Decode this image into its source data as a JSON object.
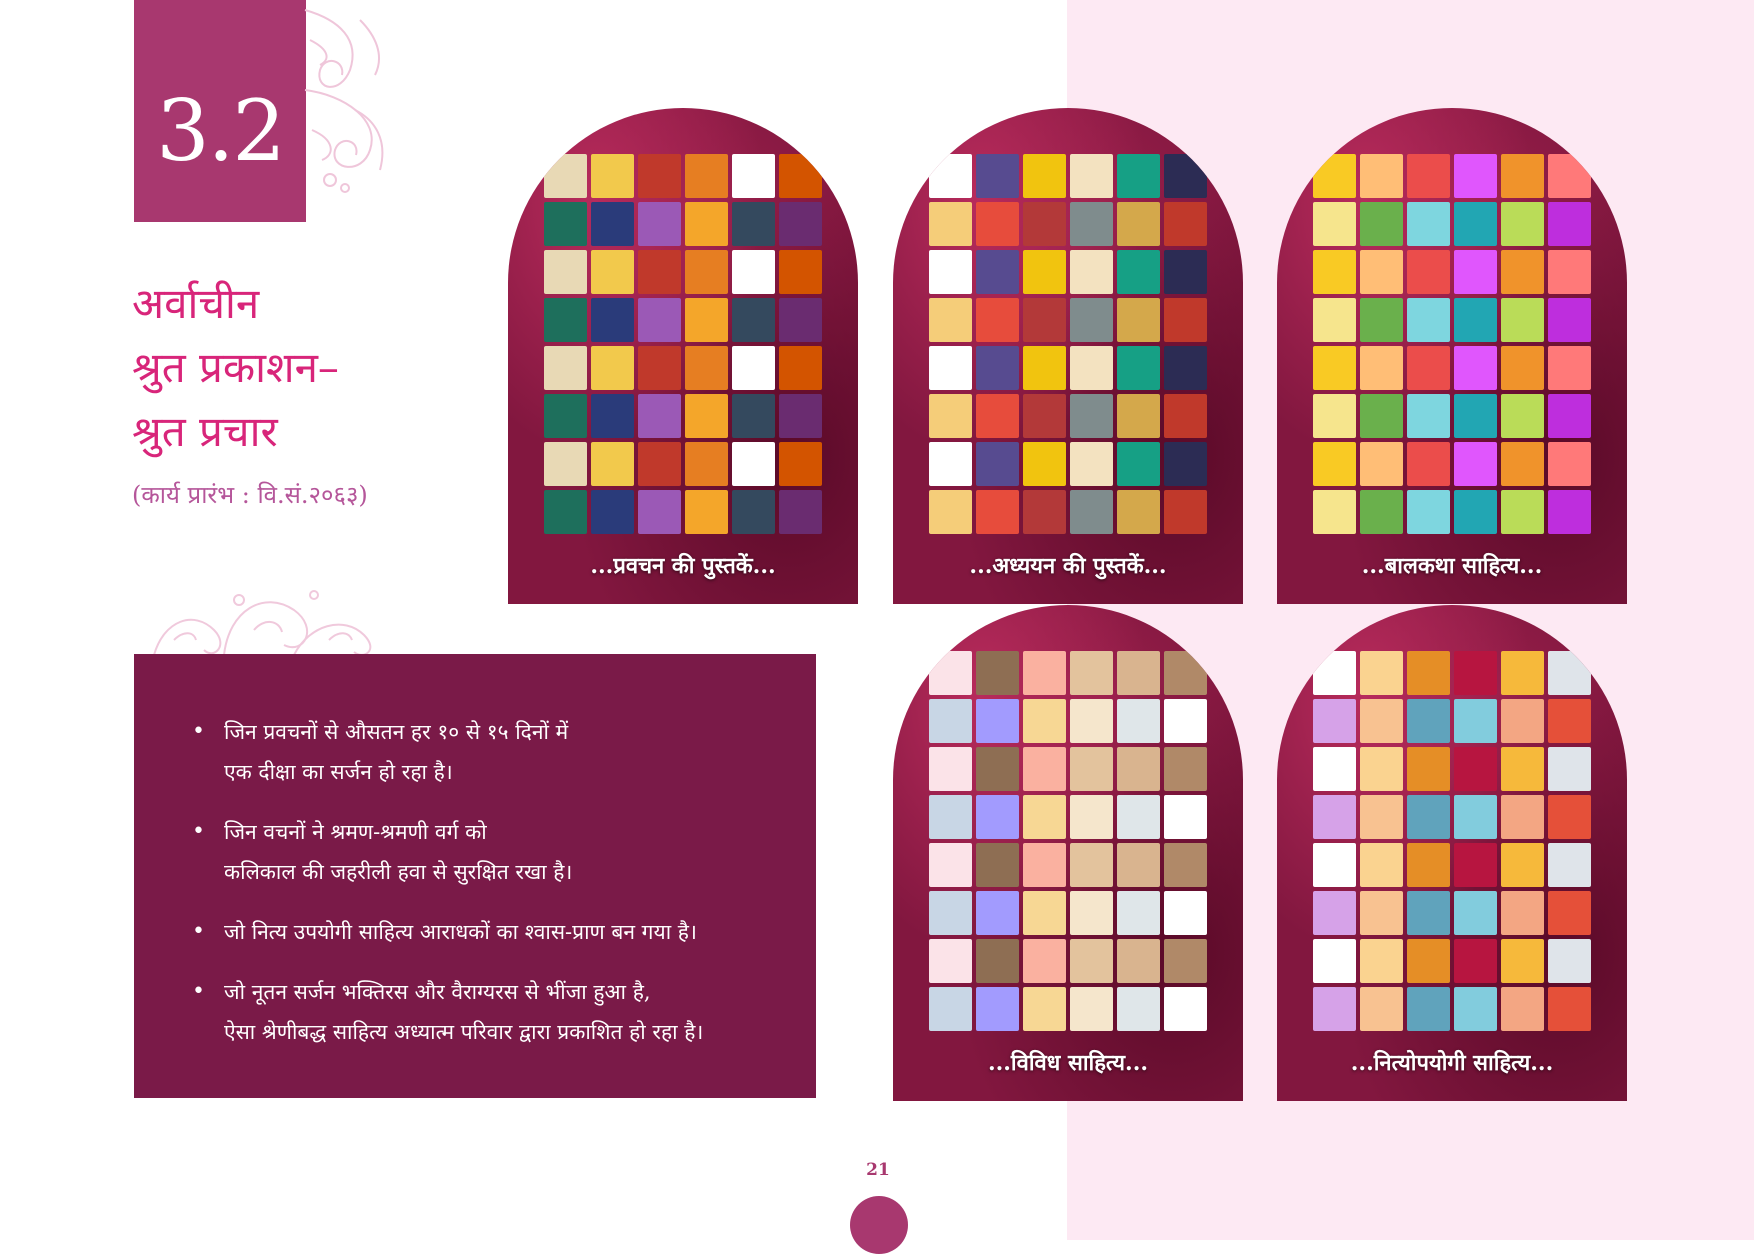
{
  "section": {
    "number": "3.2"
  },
  "title": {
    "line1": "अर्वाचीन",
    "line2": "श्रुत प्रकाशन–",
    "line3": "श्रुत प्रचार"
  },
  "subtitle": "(कार्य प्रारंभ : वि.सं.२०६३)",
  "bullets": [
    {
      "line1": "जिन प्रवचनों से औसतन हर १० से १५ दिनों में",
      "line2": "एक दीक्षा का सर्जन हो रहा है।"
    },
    {
      "line1": " जिन वचनों ने श्रमण-श्रमणी वर्ग को",
      "line2": "कलिकाल की जहरीली हवा से सुरक्षित रखा है।"
    },
    {
      "line1": "जो नित्य उपयोगी साहित्य आराधकों का श्वास-प्राण बन गया है।",
      "line2": ""
    },
    {
      "line1": "जो नूतन सर्जन भक्तिरस और वैराग्यरस से भींजा हुआ है,",
      "line2": "ऐसा श्रेणीबद्ध साहित्य अध्यात्म परिवार द्वारा प्रकाशित हो रहा है।"
    }
  ],
  "photos": [
    {
      "caption": "...प्रवचन की पुस्तकें..."
    },
    {
      "caption": "...अध्ययन की पुस्तकें..."
    },
    {
      "caption": "...बालकथा साहित्य..."
    },
    {
      "caption": "...विविध साहित्य..."
    },
    {
      "caption": "...नित्योपयोगी साहित्य..."
    }
  ],
  "page_number": "21",
  "colors": {
    "accent": "#a8386f",
    "title": "#d8257a",
    "info_box": "#7a1a48",
    "right_background": "#fde9f3",
    "velvet": "#82173f"
  }
}
